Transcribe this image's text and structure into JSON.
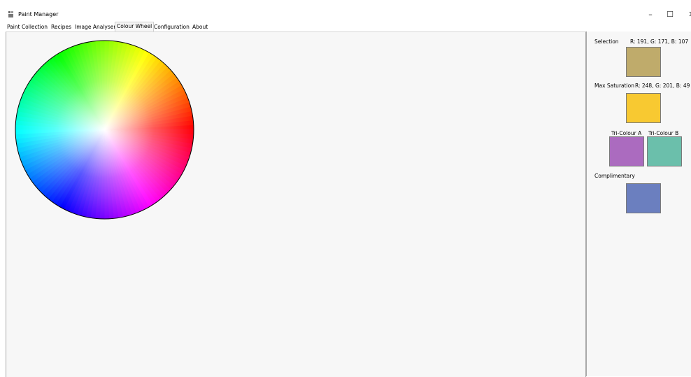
{
  "window": {
    "title": "Paint Manager",
    "controls": {
      "minimize": "–",
      "maximize": "☐",
      "close": "✕"
    }
  },
  "tabs": [
    {
      "label": "Paint Collection"
    },
    {
      "label": "Recipes"
    },
    {
      "label": "Image Analyser"
    },
    {
      "label": "Colour Wheel",
      "active": true
    },
    {
      "label": "Configuration"
    },
    {
      "label": "About"
    }
  ],
  "panel": {
    "selection": {
      "label": "Selection",
      "value": "R: 191, G: 171, B: 107",
      "color": "#bfab6b"
    },
    "max_saturation": {
      "label": "Max Saturation",
      "value": "R: 248, G: 201, B: 49",
      "color": "#f8c931"
    },
    "tri_colour_a": {
      "label": "Tri-Colour A",
      "color": "#ab6bbf"
    },
    "tri_colour_b": {
      "label": "Tri-Colour B",
      "color": "#6bbfab"
    },
    "complimentary": {
      "label": "Complimentary",
      "color": "#6b7fbf"
    }
  },
  "icons": {
    "app": "paint-app-icon"
  }
}
